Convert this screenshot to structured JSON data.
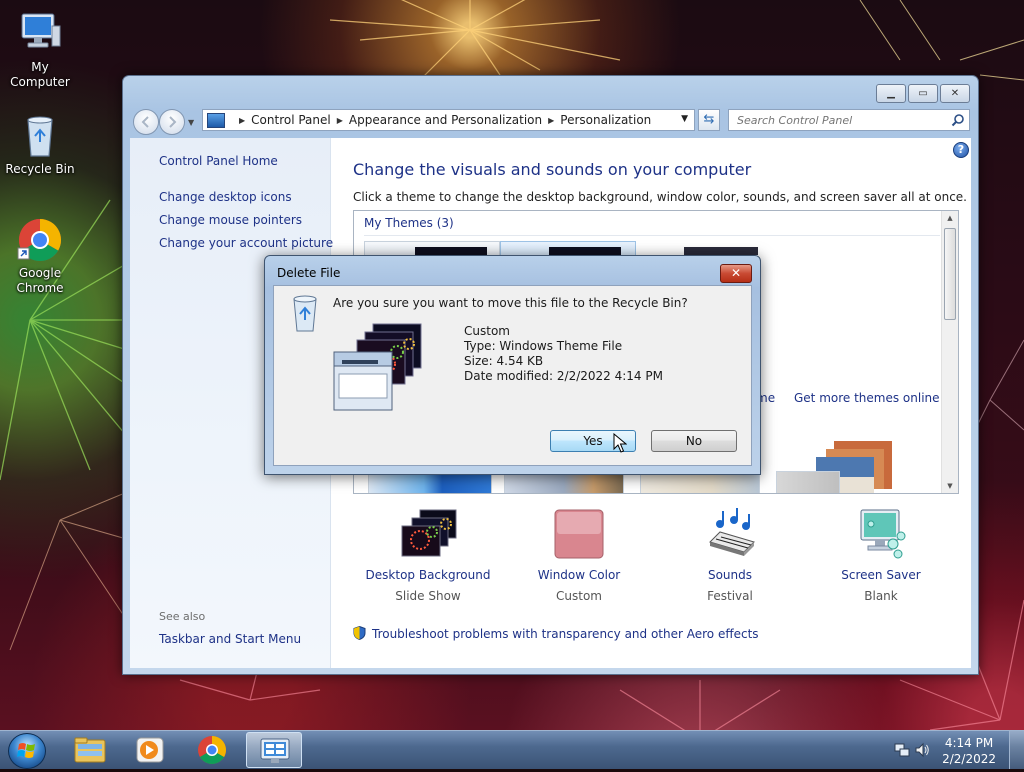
{
  "desktop": {
    "icons": [
      {
        "label": "My Computer"
      },
      {
        "label": "Recycle Bin"
      },
      {
        "label_line1": "Google",
        "label_line2": "Chrome"
      }
    ]
  },
  "control_panel": {
    "address": {
      "crumbs": [
        "Control Panel",
        "Appearance and Personalization",
        "Personalization"
      ]
    },
    "search": {
      "placeholder": "Search Control Panel"
    },
    "sidebar": {
      "home": "Control Panel Home",
      "links": [
        "Change desktop icons",
        "Change mouse pointers",
        "Change your account picture"
      ],
      "see_also_heading": "See also",
      "see_also_links": [
        "Taskbar and Start Menu"
      ]
    },
    "main": {
      "heading": "Change the visuals and sounds on your computer",
      "subheading": "Click a theme to change the desktop background, window color, sounds, and screen saver all at once.",
      "themes_group": "My Themes (3)",
      "partial_link": "me",
      "more_themes_link": "Get more themes online",
      "bottom_items": [
        {
          "label": "Desktop Background",
          "value": "Slide Show",
          "icon": "fireworks-slideshow-icon"
        },
        {
          "label": "Window Color",
          "value": "Custom",
          "icon": "window-color-icon"
        },
        {
          "label": "Sounds",
          "value": "Festival",
          "icon": "music-keyboard-icon"
        },
        {
          "label": "Screen Saver",
          "value": "Blank",
          "icon": "monitor-bubbles-icon"
        }
      ],
      "troubleshoot_link": "Troubleshoot problems with transparency and other Aero effects"
    }
  },
  "dialog": {
    "title": "Delete File",
    "close_label": "✕",
    "question": "Are you sure you want to move this file to the Recycle Bin?",
    "file": {
      "name": "Custom",
      "type": "Type: Windows Theme File",
      "size": "Size: 4.54 KB",
      "modified": "Date modified: 2/2/2022 4:14 PM"
    },
    "yes_label": "Yes",
    "no_label": "No"
  },
  "taskbar": {
    "time": "4:14 PM",
    "date": "2/2/2022",
    "buttons": [
      "file-explorer-icon",
      "media-player-icon",
      "chrome-icon",
      "control-panel-icon"
    ]
  },
  "colors": {
    "link": "#1e3287",
    "accent": "#3c7fb1",
    "close_red": "#c94a33"
  }
}
